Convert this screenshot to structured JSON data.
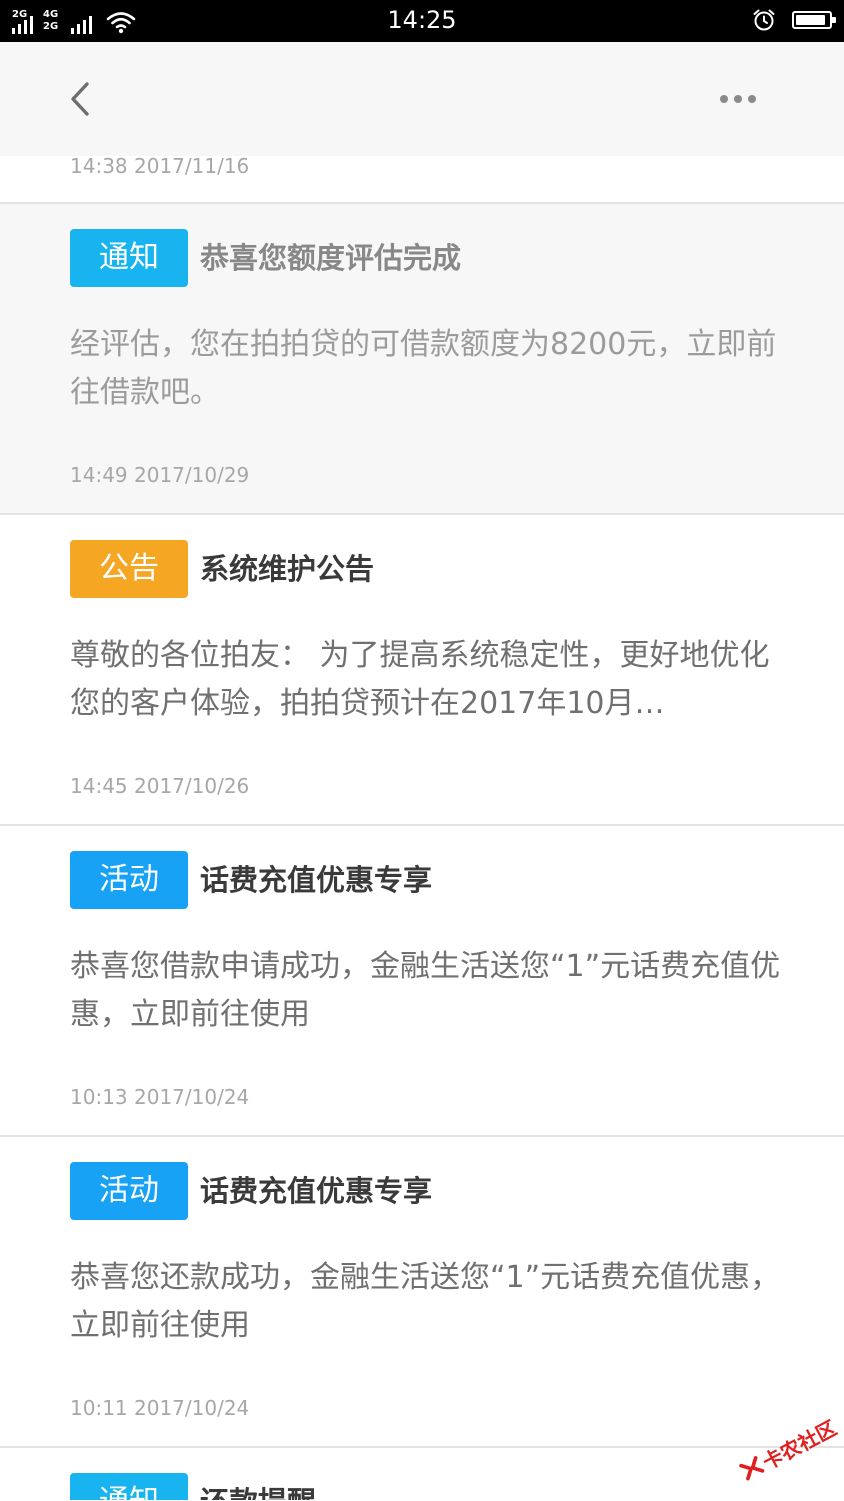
{
  "status_bar": {
    "time": "14:25",
    "sim1_label": "2G",
    "sim2_label_top": "4G",
    "sim2_label_bottom": "2G",
    "battery_level": 0.9
  },
  "nav": {
    "back_icon": "chevron-left-icon",
    "more_icon": "more-horizontal-icon"
  },
  "top_timestamp": "14:38 2017/11/16",
  "messages": [
    {
      "badge": "通知",
      "badge_color": "#17b4ef",
      "title": "恭喜您额度评估完成",
      "body": "经评估，您在拍拍贷的可借款额度为8200元，立即前往借款吧。",
      "time": "14:49 2017/10/29",
      "pressed": true
    },
    {
      "badge": "公告",
      "badge_color": "#f5a623",
      "title": "系统维护公告",
      "body": "尊敬的各位拍友：  为了提高系统稳定性，更好地优化您的客户体验，拍拍贷预计在2017年10月…",
      "time": "14:45 2017/10/26",
      "pressed": false
    },
    {
      "badge": "活动",
      "badge_color": "#17a2f5",
      "title": "话费充值优惠专享",
      "body": "恭喜您借款申请成功，金融生活送您“1”元话费充值优惠，立即前往使用",
      "time": "10:13 2017/10/24",
      "pressed": false
    },
    {
      "badge": "活动",
      "badge_color": "#17a2f5",
      "title": "话费充值优惠专享",
      "body": "恭喜您还款成功，金融生活送您“1”元话费充值优惠，立即前往使用",
      "time": "10:11 2017/10/24",
      "pressed": false
    },
    {
      "badge": "通知",
      "badge_color": "#17b4ef",
      "title": "还款提醒",
      "body": "",
      "time": "",
      "pressed": false
    }
  ],
  "watermark": {
    "text": "卡农社区",
    "color": "#e02020"
  }
}
